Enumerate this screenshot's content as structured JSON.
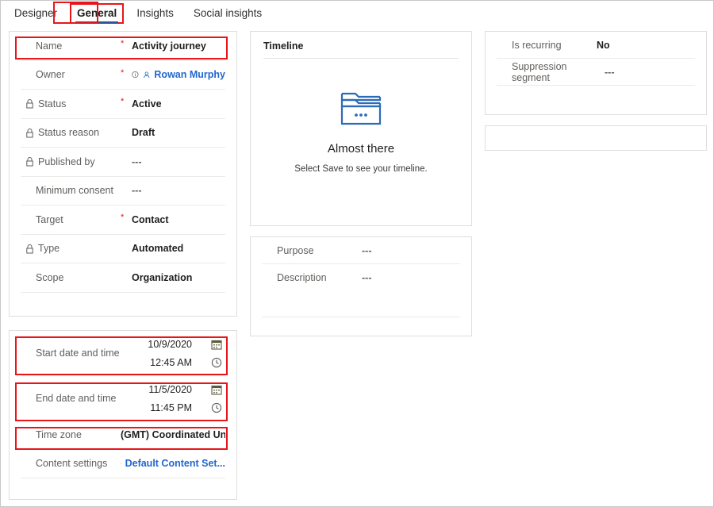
{
  "tabs": [
    {
      "label": "Designer",
      "active": false,
      "highlighted": false
    },
    {
      "label": "General",
      "active": true,
      "highlighted": true
    },
    {
      "label": "Insights",
      "active": false,
      "highlighted": false
    },
    {
      "label": "Social insights",
      "active": false,
      "highlighted": false
    }
  ],
  "general_card": {
    "rows": [
      {
        "label": "Name",
        "value": "Activity journey",
        "required": true,
        "locked": false,
        "indent": true,
        "highlighted": true
      },
      {
        "label": "Owner",
        "value": "Rowan Murphy",
        "required": true,
        "locked": false,
        "indent": true,
        "link": true
      },
      {
        "label": "Status",
        "value": "Active",
        "required": true,
        "locked": true,
        "indent": false
      },
      {
        "label": "Status reason",
        "value": "Draft",
        "required": false,
        "locked": true,
        "indent": false
      },
      {
        "label": "Published by",
        "value": "---",
        "required": false,
        "locked": true,
        "indent": false
      },
      {
        "label": "Minimum consent",
        "value": "---",
        "required": false,
        "locked": false,
        "indent": true
      },
      {
        "label": "Target",
        "value": "Contact",
        "required": true,
        "locked": false,
        "indent": true
      },
      {
        "label": "Type",
        "value": "Automated",
        "required": false,
        "locked": true,
        "indent": false
      },
      {
        "label": "Scope",
        "value": "Organization",
        "required": false,
        "locked": false,
        "indent": true
      }
    ]
  },
  "schedule_card": {
    "start": {
      "label": "Start date and time",
      "date": "10/9/2020",
      "time": "12:45 AM",
      "date_icon": "calendar-icon",
      "time_icon": "clock-icon",
      "highlighted": true
    },
    "end": {
      "label": "End date and time",
      "date": "11/5/2020",
      "time": "11:45 PM",
      "date_icon": "calendar-icon",
      "time_icon": "clock-icon",
      "highlighted": true
    },
    "timezone": {
      "label": "Time zone",
      "value": "(GMT) Coordinated Unive",
      "highlighted": true
    },
    "content_settings": {
      "label": "Content settings",
      "value": "Default Content Set...",
      "icon": "content-settings-icon"
    }
  },
  "timeline_card": {
    "title": "Timeline",
    "empty_icon": "folder-empty-icon",
    "empty_title": "Almost there",
    "empty_subtitle": "Select Save to see your timeline."
  },
  "purpose_card": {
    "rows": [
      {
        "label": "Purpose",
        "value": "---"
      },
      {
        "label": "Description",
        "value": "---"
      }
    ]
  },
  "recurrence_card": {
    "rows": [
      {
        "label": "Is recurring",
        "value": "No"
      },
      {
        "label": "Suppression segment",
        "value": "---"
      }
    ]
  },
  "colors": {
    "accent_blue": "#2266cc",
    "tab_underline": "#2b579a",
    "highlight_red": "#e8161a",
    "icon_blue": "#2b6cb8",
    "label_gray": "#605e5c",
    "card_border": "#dedede"
  }
}
